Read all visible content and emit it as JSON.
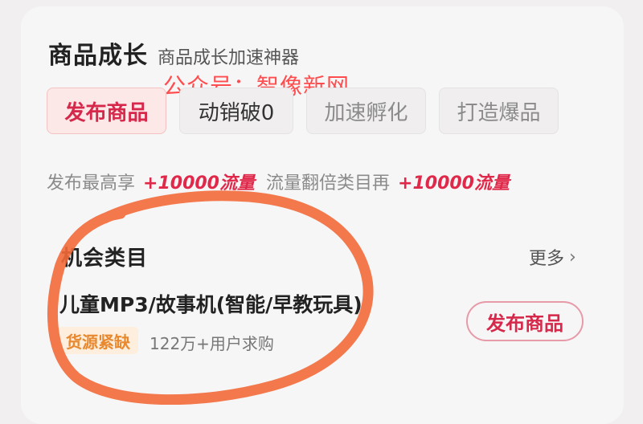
{
  "header": {
    "title": "商品成长",
    "subtitle": "商品成长加速神器"
  },
  "watermark": "公众号：智像新网",
  "tabs": [
    {
      "label": "发布商品",
      "active": true
    },
    {
      "label": "动销破0",
      "active": false
    },
    {
      "label": "加速孵化",
      "active": false
    },
    {
      "label": "打造爆品",
      "active": false
    }
  ],
  "promo": {
    "text1": "发布最高享",
    "bonus1": "+10000流量",
    "text2": "流量翻倍类目再",
    "bonus2": "+10000流量"
  },
  "opportunity": {
    "title": "机会类目",
    "more_label": "更多",
    "product_name": "儿童MP3/故事机(智能/早教玩具)",
    "tag": "货源紧缺",
    "demand": "122万+用户求购",
    "publish_button": "发布商品"
  },
  "colors": {
    "accent": "#d6284a",
    "annotation": "#f26a3a",
    "tag_bg": "#fdeedd",
    "tag_text": "#e8882f"
  }
}
